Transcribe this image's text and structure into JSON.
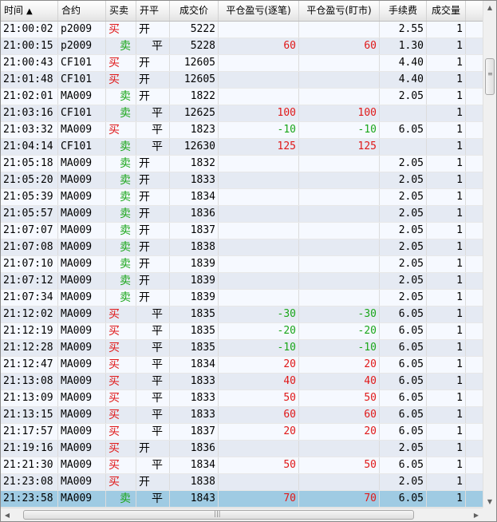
{
  "columns": [
    {
      "key": "time",
      "label": "时间",
      "sort": "▲",
      "width": 72,
      "align": "l"
    },
    {
      "key": "contract",
      "label": "合约",
      "width": 60,
      "align": "l"
    },
    {
      "key": "side",
      "label": "买卖",
      "width": 38,
      "align": "l"
    },
    {
      "key": "oc",
      "label": "开平",
      "width": 42,
      "align": "l"
    },
    {
      "key": "price",
      "label": "成交价",
      "width": 61,
      "align": "r"
    },
    {
      "key": "pnl_trade",
      "label": "平仓盈亏(逐笔)",
      "width": 101,
      "align": "r"
    },
    {
      "key": "pnl_mtm",
      "label": "平仓盈亏(盯市)",
      "width": 101,
      "align": "r"
    },
    {
      "key": "fee",
      "label": "手续费",
      "width": 59,
      "align": "r"
    },
    {
      "key": "qty",
      "label": "成交量",
      "width": 49,
      "align": "r"
    }
  ],
  "rows": [
    {
      "time": "21:00:02",
      "contract": "p2009",
      "side": "买",
      "oc": "开",
      "price": "5222",
      "pnl_trade": "",
      "pnl_mtm": "",
      "fee": "2.55",
      "qty": "1"
    },
    {
      "time": "21:00:15",
      "contract": "p2009",
      "side": "卖",
      "oc": "平",
      "price": "5228",
      "pnl_trade": "60",
      "pnl_mtm": "60",
      "fee": "1.30",
      "qty": "1"
    },
    {
      "time": "21:00:43",
      "contract": "CF101",
      "side": "买",
      "oc": "开",
      "price": "12605",
      "pnl_trade": "",
      "pnl_mtm": "",
      "fee": "4.40",
      "qty": "1"
    },
    {
      "time": "21:01:48",
      "contract": "CF101",
      "side": "买",
      "oc": "开",
      "price": "12605",
      "pnl_trade": "",
      "pnl_mtm": "",
      "fee": "4.40",
      "qty": "1"
    },
    {
      "time": "21:02:01",
      "contract": "MA009",
      "side": "卖",
      "oc": "开",
      "price": "1822",
      "pnl_trade": "",
      "pnl_mtm": "",
      "fee": "2.05",
      "qty": "1"
    },
    {
      "time": "21:03:16",
      "contract": "CF101",
      "side": "卖",
      "oc": "平",
      "price": "12625",
      "pnl_trade": "100",
      "pnl_mtm": "100",
      "fee": "",
      "qty": "1"
    },
    {
      "time": "21:03:32",
      "contract": "MA009",
      "side": "买",
      "oc": "平",
      "price": "1823",
      "pnl_trade": "-10",
      "pnl_mtm": "-10",
      "fee": "6.05",
      "qty": "1"
    },
    {
      "time": "21:04:14",
      "contract": "CF101",
      "side": "卖",
      "oc": "平",
      "price": "12630",
      "pnl_trade": "125",
      "pnl_mtm": "125",
      "fee": "",
      "qty": "1"
    },
    {
      "time": "21:05:18",
      "contract": "MA009",
      "side": "卖",
      "oc": "开",
      "price": "1832",
      "pnl_trade": "",
      "pnl_mtm": "",
      "fee": "2.05",
      "qty": "1"
    },
    {
      "time": "21:05:20",
      "contract": "MA009",
      "side": "卖",
      "oc": "开",
      "price": "1833",
      "pnl_trade": "",
      "pnl_mtm": "",
      "fee": "2.05",
      "qty": "1"
    },
    {
      "time": "21:05:39",
      "contract": "MA009",
      "side": "卖",
      "oc": "开",
      "price": "1834",
      "pnl_trade": "",
      "pnl_mtm": "",
      "fee": "2.05",
      "qty": "1"
    },
    {
      "time": "21:05:57",
      "contract": "MA009",
      "side": "卖",
      "oc": "开",
      "price": "1836",
      "pnl_trade": "",
      "pnl_mtm": "",
      "fee": "2.05",
      "qty": "1"
    },
    {
      "time": "21:07:07",
      "contract": "MA009",
      "side": "卖",
      "oc": "开",
      "price": "1837",
      "pnl_trade": "",
      "pnl_mtm": "",
      "fee": "2.05",
      "qty": "1"
    },
    {
      "time": "21:07:08",
      "contract": "MA009",
      "side": "卖",
      "oc": "开",
      "price": "1838",
      "pnl_trade": "",
      "pnl_mtm": "",
      "fee": "2.05",
      "qty": "1"
    },
    {
      "time": "21:07:10",
      "contract": "MA009",
      "side": "卖",
      "oc": "开",
      "price": "1839",
      "pnl_trade": "",
      "pnl_mtm": "",
      "fee": "2.05",
      "qty": "1"
    },
    {
      "time": "21:07:12",
      "contract": "MA009",
      "side": "卖",
      "oc": "开",
      "price": "1839",
      "pnl_trade": "",
      "pnl_mtm": "",
      "fee": "2.05",
      "qty": "1"
    },
    {
      "time": "21:07:34",
      "contract": "MA009",
      "side": "卖",
      "oc": "开",
      "price": "1839",
      "pnl_trade": "",
      "pnl_mtm": "",
      "fee": "2.05",
      "qty": "1"
    },
    {
      "time": "21:12:02",
      "contract": "MA009",
      "side": "买",
      "oc": "平",
      "price": "1835",
      "pnl_trade": "-30",
      "pnl_mtm": "-30",
      "fee": "6.05",
      "qty": "1"
    },
    {
      "time": "21:12:19",
      "contract": "MA009",
      "side": "买",
      "oc": "平",
      "price": "1835",
      "pnl_trade": "-20",
      "pnl_mtm": "-20",
      "fee": "6.05",
      "qty": "1"
    },
    {
      "time": "21:12:28",
      "contract": "MA009",
      "side": "买",
      "oc": "平",
      "price": "1835",
      "pnl_trade": "-10",
      "pnl_mtm": "-10",
      "fee": "6.05",
      "qty": "1"
    },
    {
      "time": "21:12:47",
      "contract": "MA009",
      "side": "买",
      "oc": "平",
      "price": "1834",
      "pnl_trade": "20",
      "pnl_mtm": "20",
      "fee": "6.05",
      "qty": "1"
    },
    {
      "time": "21:13:08",
      "contract": "MA009",
      "side": "买",
      "oc": "平",
      "price": "1833",
      "pnl_trade": "40",
      "pnl_mtm": "40",
      "fee": "6.05",
      "qty": "1"
    },
    {
      "time": "21:13:09",
      "contract": "MA009",
      "side": "买",
      "oc": "平",
      "price": "1833",
      "pnl_trade": "50",
      "pnl_mtm": "50",
      "fee": "6.05",
      "qty": "1"
    },
    {
      "time": "21:13:15",
      "contract": "MA009",
      "side": "买",
      "oc": "平",
      "price": "1833",
      "pnl_trade": "60",
      "pnl_mtm": "60",
      "fee": "6.05",
      "qty": "1"
    },
    {
      "time": "21:17:57",
      "contract": "MA009",
      "side": "买",
      "oc": "平",
      "price": "1837",
      "pnl_trade": "20",
      "pnl_mtm": "20",
      "fee": "6.05",
      "qty": "1"
    },
    {
      "time": "21:19:16",
      "contract": "MA009",
      "side": "买",
      "oc": "开",
      "price": "1836",
      "pnl_trade": "",
      "pnl_mtm": "",
      "fee": "2.05",
      "qty": "1"
    },
    {
      "time": "21:21:30",
      "contract": "MA009",
      "side": "买",
      "oc": "平",
      "price": "1834",
      "pnl_trade": "50",
      "pnl_mtm": "50",
      "fee": "6.05",
      "qty": "1"
    },
    {
      "time": "21:23:08",
      "contract": "MA009",
      "side": "买",
      "oc": "开",
      "price": "1838",
      "pnl_trade": "",
      "pnl_mtm": "",
      "fee": "2.05",
      "qty": "1"
    },
    {
      "time": "21:23:58",
      "contract": "MA009",
      "side": "卖",
      "oc": "平",
      "price": "1843",
      "pnl_trade": "70",
      "pnl_mtm": "70",
      "fee": "6.05",
      "qty": "1",
      "selected": true
    }
  ],
  "colors": {
    "buy": "#e01818",
    "sell": "#1aa61a",
    "selected_row": "#9fcbe3"
  },
  "icons": {
    "sort": "sort-ascending-icon",
    "scroll_up": "arrow-up-icon",
    "scroll_down": "arrow-down-icon",
    "scroll_left": "arrow-left-icon",
    "scroll_right": "arrow-right-icon"
  },
  "scrollbars": {
    "vertical_position": 0.1,
    "horizontal_position": 0.15
  }
}
